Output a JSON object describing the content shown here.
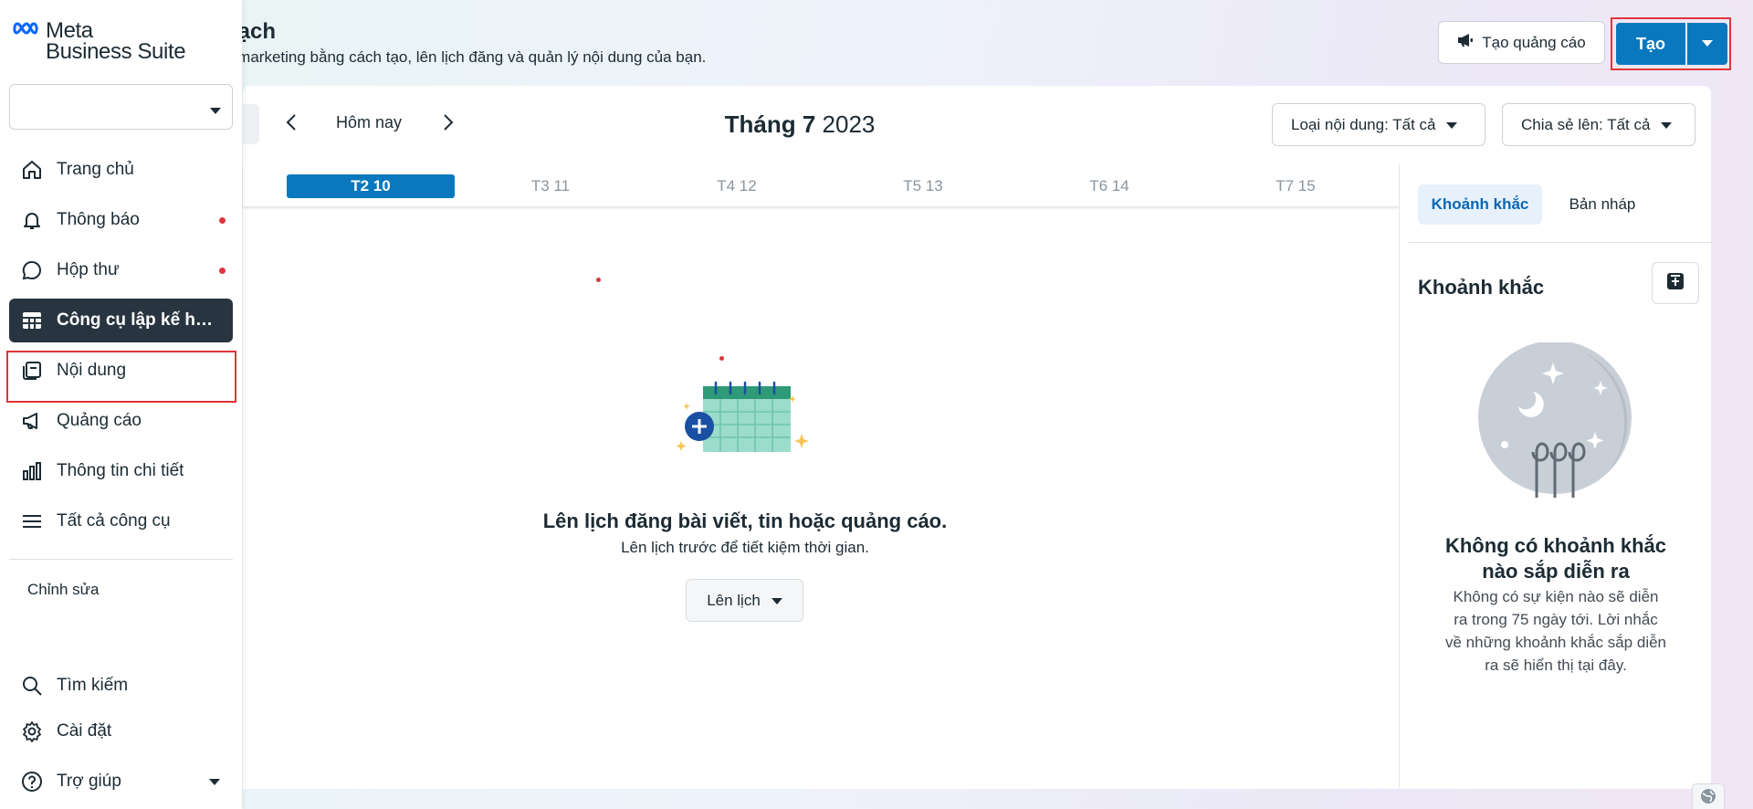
{
  "header": {
    "title_fragment": "oạch",
    "subtitle_fragment": "n marketing bằng cách tạo, lên lịch đăng và quản lý nội dung của bạn.",
    "create_ad_label": "Tạo quảng cáo",
    "create_label": "Tạo"
  },
  "sidebar": {
    "brand_line1": "Meta",
    "brand_line2": "Business Suite",
    "account_value": "",
    "items": [
      {
        "label": "Trang chủ",
        "icon": "home-icon"
      },
      {
        "label": "Thông báo",
        "icon": "bell-icon",
        "badge": true
      },
      {
        "label": "Hộp thư",
        "icon": "chat-bubble-icon",
        "badge": true
      },
      {
        "label": "Công cụ lập kế hoạch",
        "icon": "calendar-grid-icon",
        "active": true
      },
      {
        "label": "Nội dung",
        "icon": "content-pages-icon"
      },
      {
        "label": "Quảng cáo",
        "icon": "megaphone-icon"
      },
      {
        "label": "Thông tin chi tiết",
        "icon": "bar-chart-icon"
      },
      {
        "label": "Tất cả công cụ",
        "icon": "menu-lines-icon"
      }
    ],
    "edit_label": "Chỉnh sửa",
    "bottom_items": [
      {
        "label": "Tìm kiếm",
        "icon": "search-icon"
      },
      {
        "label": "Cài đặt",
        "icon": "gear-icon"
      },
      {
        "label": "Trợ giúp",
        "icon": "help-circle-icon"
      }
    ]
  },
  "toolbar": {
    "today_label": "Hôm nay",
    "month_name": "Tháng 7",
    "year": "2023",
    "content_filter": "Loại nội dung: Tất cả",
    "share_filter": "Chia sẻ lên: Tất cả"
  },
  "week": {
    "days": [
      "T2 10",
      "T3 11",
      "T4 12",
      "T5 13",
      "T6 14",
      "T7 15"
    ],
    "active_index": 0
  },
  "empty_state": {
    "title": "Lên lịch đăng bài viết, tin hoặc quảng cáo.",
    "subtitle": "Lên lịch trước để tiết kiệm thời gian.",
    "button_label": "Lên lịch"
  },
  "right_panel": {
    "tab_moments": "Khoảnh khắc",
    "tab_drafts": "Bản nháp",
    "heading": "Khoảnh khắc",
    "empty_title": "Không có khoảnh khắc nào sắp diễn ra",
    "empty_text": "Không có sự kiện nào sẽ diễn ra trong 75 ngày tới. Lời nhắc về những khoảnh khắc sắp diễn ra sẽ hiển thị tại đây."
  },
  "colors": {
    "primary": "#0a78be",
    "highlight": "#e0353b",
    "active_nav": "#283540"
  }
}
